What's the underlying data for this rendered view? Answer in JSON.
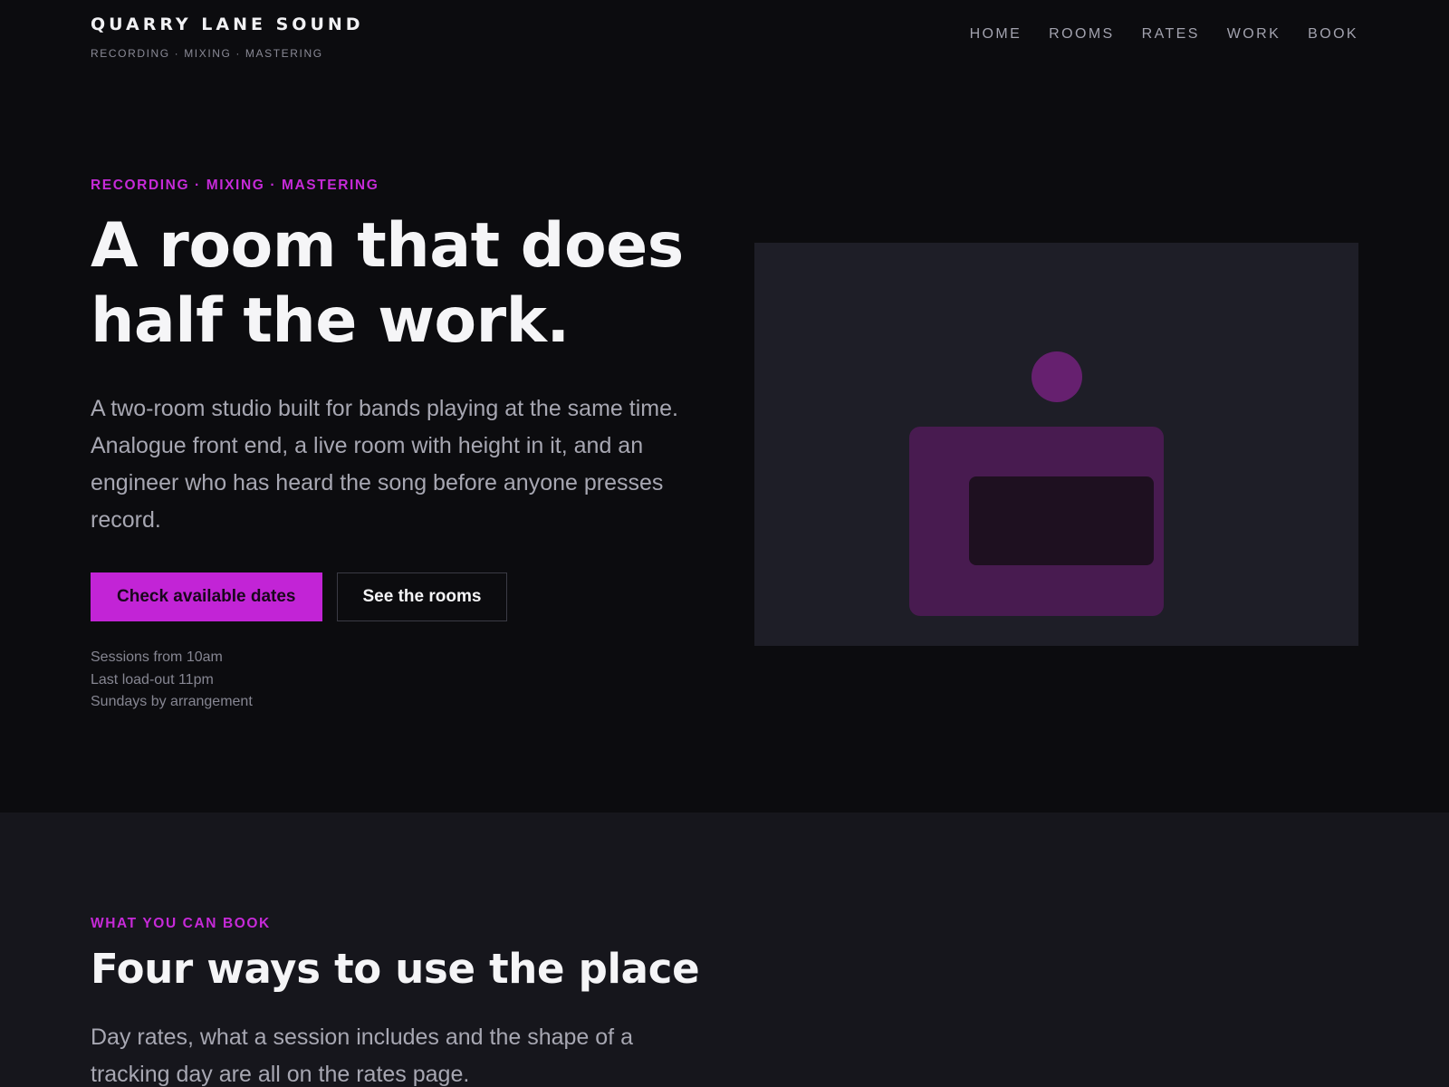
{
  "header": {
    "brand_name": "QUARRY LANE SOUND",
    "brand_tagline": "RECORDING · MIXING · MASTERING",
    "nav": [
      "HOME",
      "ROOMS",
      "RATES",
      "WORK",
      "BOOK"
    ]
  },
  "hero": {
    "eyebrow": "RECORDING · MIXING · MASTERING",
    "title_lines": [
      "A room that does",
      "half the work."
    ],
    "lede": "A two-room studio built for bands playing at the same time. Analogue front end, a live room with height in it, and an engineer who has heard the song before anyone presses record.",
    "primary_cta": "Check available dates",
    "secondary_cta": "See the rooms",
    "hours": [
      "Sessions from 10am",
      "Last load-out 11pm",
      "Sundays by arrangement"
    ]
  },
  "offerings": {
    "eyebrow": "WHAT YOU CAN BOOK",
    "title": "Four ways to use the place",
    "lede": "Day rates, what a session includes and the shape of a tracking day are all on the rates page."
  },
  "colors": {
    "accent": "#c224d6",
    "background": "#0c0c0f",
    "panel": "#1e1e27",
    "section_background": "#16161c"
  },
  "icons": {
    "hero_illustration": "studio-console-icon"
  }
}
